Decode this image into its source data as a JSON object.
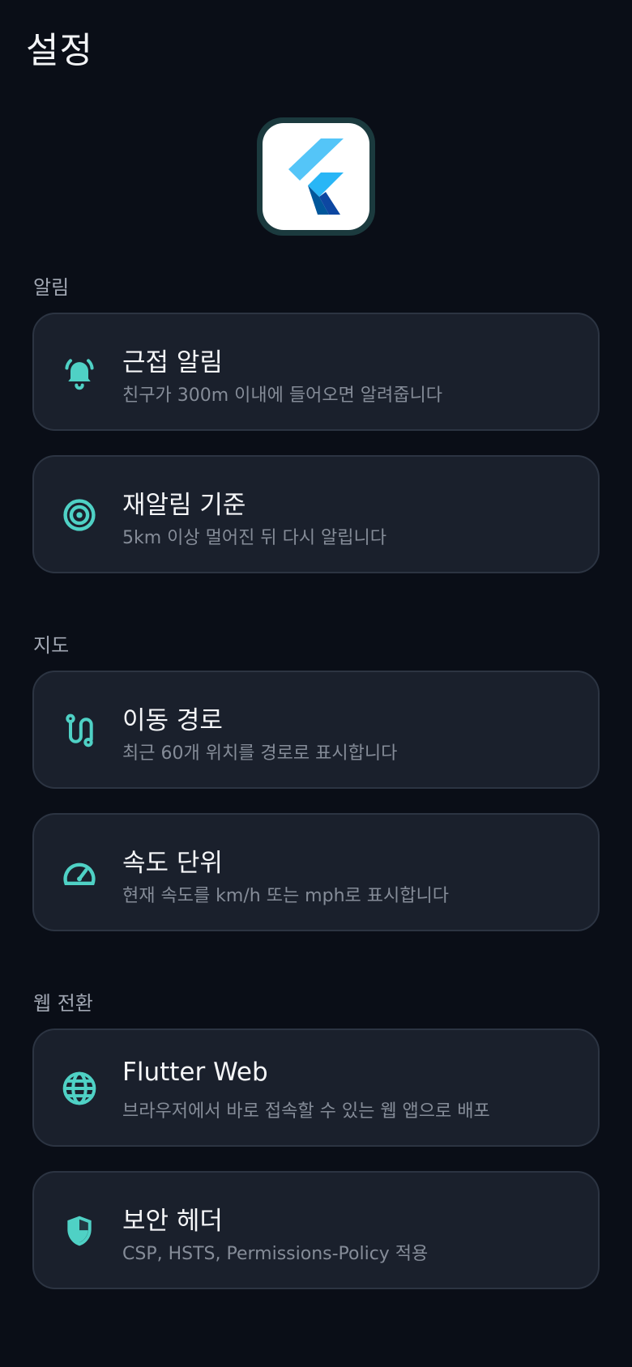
{
  "header": {
    "title": "설정"
  },
  "colors": {
    "background": "#0a0e17",
    "card": "#1a202c",
    "card_border": "#2c3442",
    "accent": "#4fd1c5",
    "section_label": "#a1a7b3",
    "subtitle": "#858c98"
  },
  "logo": {
    "icon": "flutter-logo-icon"
  },
  "sections": [
    {
      "label": "알림",
      "items": [
        {
          "icon": "bell-ring-icon",
          "title": "근접 알림",
          "subtitle": "친구가 300m 이내에 들어오면 알려줍니다"
        },
        {
          "icon": "target-icon",
          "title": "재알림 기준",
          "subtitle": "5km 이상 멀어진 뒤 다시 알립니다"
        }
      ]
    },
    {
      "label": "지도",
      "items": [
        {
          "icon": "route-icon",
          "title": "이동 경로",
          "subtitle": "최근 60개 위치를 경로로 표시합니다"
        },
        {
          "icon": "speedometer-icon",
          "title": "속도 단위",
          "subtitle": "현재 속도를 km/h 또는 mph로 표시합니다"
        }
      ]
    },
    {
      "label": "웹 전환",
      "items": [
        {
          "icon": "globe-icon",
          "title": "Flutter Web",
          "subtitle": "브라우저에서 바로 접속할 수 있는 웹 앱으로 배포"
        },
        {
          "icon": "shield-icon",
          "title": "보안 헤더",
          "subtitle": "CSP, HSTS, Permissions-Policy 적용"
        }
      ]
    }
  ]
}
